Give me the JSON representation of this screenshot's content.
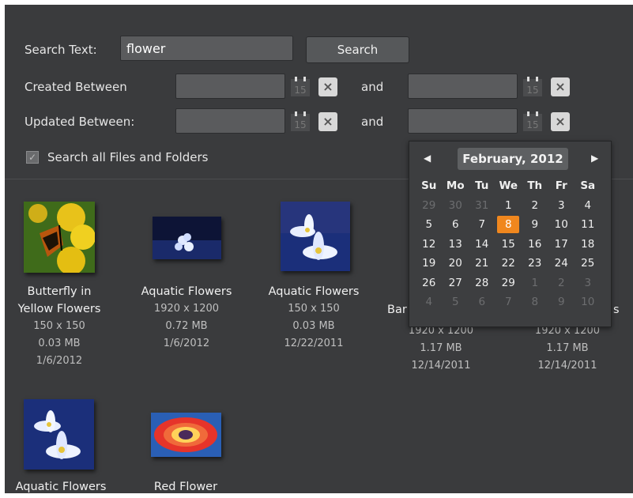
{
  "search": {
    "label": "Search Text:",
    "value": "flower",
    "button": "Search"
  },
  "created": {
    "label": "Created Between",
    "and": "and",
    "calendar_icon_text": "15",
    "clear_icon": "×"
  },
  "updated": {
    "label": "Updated Between:",
    "and": "and",
    "calendar_icon_text": "15",
    "clear_icon": "×"
  },
  "scope": {
    "label": "Search all Files and Folders",
    "checked": true
  },
  "calendar": {
    "month": "February, 2012",
    "prev": "◀",
    "next": "▶",
    "weekdays": [
      "Su",
      "Mo",
      "Tu",
      "We",
      "Th",
      "Fr",
      "Sa"
    ],
    "weeks": [
      [
        "29",
        "30",
        "31",
        "1",
        "2",
        "3",
        "4"
      ],
      [
        "5",
        "6",
        "7",
        "8",
        "9",
        "10",
        "11"
      ],
      [
        "12",
        "13",
        "14",
        "15",
        "16",
        "17",
        "18"
      ],
      [
        "19",
        "20",
        "21",
        "22",
        "23",
        "24",
        "25"
      ],
      [
        "26",
        "27",
        "28",
        "29",
        "1",
        "2",
        "3"
      ],
      [
        "4",
        "5",
        "6",
        "7",
        "8",
        "9",
        "10"
      ]
    ],
    "selected": "8",
    "accent": "#f0871e"
  },
  "results": [
    {
      "title1": "Butterfly in",
      "title2": "Yellow Flowers",
      "dims": "150 x 150",
      "size": "0.03 MB",
      "date": "1/6/2012"
    },
    {
      "title1": "Aquatic Flowers",
      "dims": "1920 x 1200",
      "size": "0.72 MB",
      "date": "1/6/2012"
    },
    {
      "title1": "Aquatic Flowers",
      "dims": "150 x 150",
      "size": "0.03 MB",
      "date": "12/22/2011"
    },
    {
      "title1": "Bar",
      "dims": "1920 x 1200",
      "size": "1.17 MB",
      "date": "12/14/2011"
    },
    {
      "title1": "s",
      "dims": "1920 x 1200",
      "size": "1.17 MB",
      "date": "12/14/2011"
    },
    {
      "title1": "Aquatic Flowers"
    },
    {
      "title1": "Red Flower"
    }
  ]
}
